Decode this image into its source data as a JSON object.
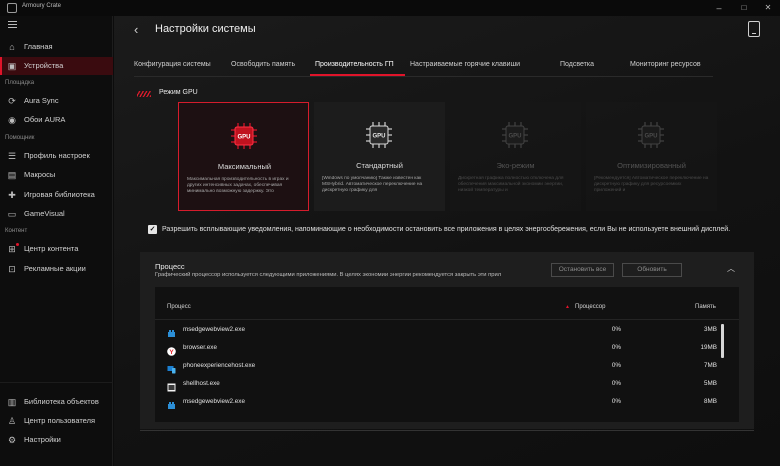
{
  "app": {
    "title": "Armoury Crate"
  },
  "window": {
    "minimize": "–",
    "maximize": "□",
    "close": "✕"
  },
  "sidebar": {
    "items": [
      {
        "label": "Главная",
        "icon": "home-icon"
      },
      {
        "label": "Устройства",
        "icon": "devices-icon",
        "active": true
      },
      {
        "label": "Aura Sync",
        "icon": "aura-sync-icon"
      },
      {
        "label": "Обои AURA",
        "icon": "aura-wallpaper-icon"
      },
      {
        "label": "Профиль настроек",
        "icon": "profile-sliders-icon"
      },
      {
        "label": "Макросы",
        "icon": "macros-icon"
      },
      {
        "label": "Игровая библиотека",
        "icon": "game-library-icon"
      },
      {
        "label": "GameVisual",
        "icon": "gamevisual-icon"
      },
      {
        "label": "Центр контента",
        "icon": "content-center-icon"
      },
      {
        "label": "Рекламные акции",
        "icon": "promotions-icon"
      },
      {
        "label": "Библиотека объектов",
        "icon": "object-library-icon"
      },
      {
        "label": "Центр пользователя",
        "icon": "user-center-icon"
      },
      {
        "label": "Настройки",
        "icon": "settings-gear-icon"
      }
    ],
    "sections": {
      "platform": "Площадка",
      "help": "Помощник",
      "content": "Контент"
    }
  },
  "header": {
    "title": "Настройки системы"
  },
  "tabs": [
    {
      "label": "Конфигурация системы"
    },
    {
      "label": "Освободить память"
    },
    {
      "label": "Производительность ГП",
      "active": true
    },
    {
      "label": "Настраиваемые горячие клавиши"
    },
    {
      "label": "Подсветка"
    },
    {
      "label": "Мониторинг ресурсов"
    }
  ],
  "gpu_mode": {
    "title": "Режим GPU",
    "cards": [
      {
        "name": "Максимальный",
        "state": "active",
        "desc": "Максимальная производительность в играх и других интенсивных задачах, обеспечивая минимально возможную задержку. Это"
      },
      {
        "name": "Стандартный",
        "state": "normal",
        "desc": "[Windows по умолчанию] Также известен как MSHybrid. Автоматическое переключение на дискретную графику для"
      },
      {
        "name": "Эко-режим",
        "state": "disabled",
        "desc": "Дискретная графика полностью отключена для обеспечения максимальной экономии энергии, низкой температуры и"
      },
      {
        "name": "Оптимизированный",
        "state": "disabled",
        "desc": "[Рекомендуется] Автоматическое переключение на дискретную графику для ресурсоемких приложений и"
      }
    ]
  },
  "notify": {
    "checked": "✓",
    "text": "Разрешить всплывающие уведомления, напоминающие о необходимости остановить все приложения в целях энергосбережения, если Вы не используете внешний дисплей."
  },
  "process_panel": {
    "title": "Процесс",
    "subtitle": "Графический процессор используется следующими приложениями. В целях экономии энергии рекомендуется закрыть эти прил",
    "stop_all": "Остановить все",
    "refresh": "Обновить",
    "collapse": "︿",
    "columns": {
      "process": "Процесс",
      "cpu": "Процессор",
      "mem": "Память",
      "sort": "▲"
    },
    "rows": [
      {
        "name": "msedgewebview2.exe",
        "cpu": "0%",
        "mem": "3MB",
        "icon": "edge-webview-icon"
      },
      {
        "name": "browser.exe",
        "cpu": "0%",
        "mem": "19MB",
        "icon": "yandex-browser-icon"
      },
      {
        "name": "phoneexperiencehost.exe",
        "cpu": "0%",
        "mem": "7MB",
        "icon": "phone-link-icon"
      },
      {
        "name": "shellhost.exe",
        "cpu": "0%",
        "mem": "5MB",
        "icon": "shellhost-icon"
      },
      {
        "name": "msedgewebview2.exe",
        "cpu": "0%",
        "mem": "8MB",
        "icon": "edge-webview-icon"
      }
    ]
  },
  "colors": {
    "accent": "#e0142a",
    "bg": "#121212",
    "panel": "#1e1e1e"
  }
}
